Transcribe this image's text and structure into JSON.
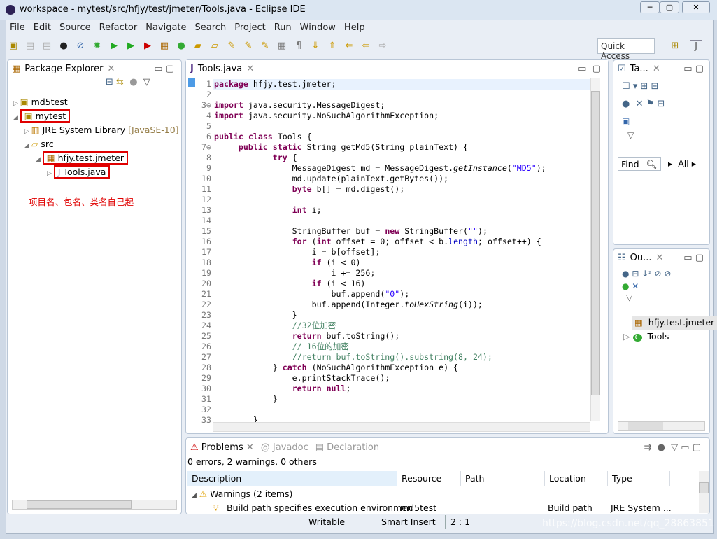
{
  "window": {
    "title": "workspace - mytest/src/hfjy/test/jmeter/Tools.java - Eclipse IDE"
  },
  "menu": [
    "File",
    "Edit",
    "Source",
    "Refactor",
    "Navigate",
    "Search",
    "Project",
    "Run",
    "Window",
    "Help"
  ],
  "toolbar": {
    "quick_access": "Quick Access"
  },
  "package_explorer": {
    "title": "Package Explorer",
    "items": [
      {
        "label": "md5test",
        "depth": 0,
        "icon": "project-icon",
        "arrow": "▷"
      },
      {
        "label": "mytest",
        "depth": 0,
        "icon": "project-icon",
        "arrow": "◢",
        "boxed": true
      },
      {
        "label": "JRE System Library",
        "extra": "[JavaSE-10]",
        "depth": 1,
        "icon": "library-icon",
        "arrow": "▷"
      },
      {
        "label": "src",
        "depth": 1,
        "icon": "folder-icon",
        "arrow": "◢"
      },
      {
        "label": "hfjy.test.jmeter",
        "depth": 2,
        "icon": "package-icon",
        "arrow": "◢",
        "boxed": true
      },
      {
        "label": "Tools.java",
        "depth": 3,
        "icon": "java-file-icon",
        "arrow": "▷",
        "boxed": true
      }
    ],
    "annotation": "项目名、包名、类名自己起",
    "annotation_color": "#e00000"
  },
  "editor": {
    "tab": "Tools.java",
    "lines": [
      [
        [
          "package",
          "k"
        ],
        [
          " hfjy.test.jmeter;"
        ]
      ],
      [],
      [
        [
          "import",
          "k"
        ],
        [
          " java.security.MessageDigest;"
        ]
      ],
      [
        [
          "import",
          "k"
        ],
        [
          " java.security.NoSuchAlgorithmException;"
        ]
      ],
      [],
      [
        [
          "public",
          "k"
        ],
        [
          " "
        ],
        [
          "class",
          "k"
        ],
        [
          " Tools {"
        ]
      ],
      [
        [
          "     "
        ],
        [
          "public",
          "k"
        ],
        [
          " "
        ],
        [
          "static",
          "k"
        ],
        [
          " String getMd5(String plainText) {"
        ]
      ],
      [
        [
          "            "
        ],
        [
          "try",
          "k"
        ],
        [
          " {"
        ]
      ],
      [
        [
          "                MessageDigest md = MessageDigest."
        ],
        [
          "getInstance",
          "i"
        ],
        [
          "("
        ],
        [
          "\"MD5\"",
          "s"
        ],
        [
          ");"
        ]
      ],
      [
        [
          "                md.update(plainText.getBytes());"
        ]
      ],
      [
        [
          "                "
        ],
        [
          "byte",
          "k"
        ],
        [
          " b[] = md.digest();"
        ]
      ],
      [],
      [
        [
          "                "
        ],
        [
          "int",
          "k"
        ],
        [
          " i;"
        ]
      ],
      [],
      [
        [
          "                StringBuffer buf = "
        ],
        [
          "new",
          "k"
        ],
        [
          " StringBuffer("
        ],
        [
          "\"\"",
          "s"
        ],
        [
          ");"
        ]
      ],
      [
        [
          "                "
        ],
        [
          "for",
          "k"
        ],
        [
          " ("
        ],
        [
          "int",
          "k"
        ],
        [
          " offset = 0; offset < b."
        ],
        [
          "length",
          "f"
        ],
        [
          "; offset++) {"
        ]
      ],
      [
        [
          "                    i = b[offset];"
        ]
      ],
      [
        [
          "                    "
        ],
        [
          "if",
          "k"
        ],
        [
          " (i < 0)"
        ]
      ],
      [
        [
          "                        i += 256;"
        ]
      ],
      [
        [
          "                    "
        ],
        [
          "if",
          "k"
        ],
        [
          " (i < 16)"
        ]
      ],
      [
        [
          "                        buf.append("
        ],
        [
          "\"0\"",
          "s"
        ],
        [
          ");"
        ]
      ],
      [
        [
          "                    buf.append(Integer."
        ],
        [
          "toHexString",
          "i"
        ],
        [
          "(i));"
        ]
      ],
      [
        [
          "                }"
        ]
      ],
      [
        [
          "                "
        ],
        [
          "//32位加密",
          "c"
        ]
      ],
      [
        [
          "                "
        ],
        [
          "return",
          "k"
        ],
        [
          " buf.toString();"
        ]
      ],
      [
        [
          "                "
        ],
        [
          "// 16位的加密",
          "c"
        ]
      ],
      [
        [
          "                "
        ],
        [
          "//return buf.toString().substring(8, 24);",
          "c"
        ]
      ],
      [
        [
          "            } "
        ],
        [
          "catch",
          "k"
        ],
        [
          " (NoSuchAlgorithmException e) {"
        ]
      ],
      [
        [
          "                e.printStackTrace();"
        ]
      ],
      [
        [
          "                "
        ],
        [
          "return",
          "k"
        ],
        [
          " "
        ],
        [
          "null",
          "k"
        ],
        [
          ";"
        ]
      ],
      [
        [
          "            }"
        ]
      ],
      [],
      [
        [
          "        }"
        ]
      ]
    ]
  },
  "task_panel": {
    "title": "Ta...",
    "find": "Find",
    "all": "All"
  },
  "outline": {
    "title": "Ou...",
    "items": [
      "hfjy.test.jmeter",
      "Tools"
    ]
  },
  "problems": {
    "tabs": [
      "Problems",
      "Javadoc",
      "Declaration"
    ],
    "summary": "0 errors, 2 warnings, 0 others",
    "columns": [
      "Description",
      "Resource",
      "Path",
      "Location",
      "Type"
    ],
    "group": "Warnings (2 items)",
    "row": [
      "Build path specifies execution environmen",
      "md5test",
      "",
      "Build path",
      "JRE System ..."
    ]
  },
  "statusbar": {
    "writable": "Writable",
    "insert": "Smart Insert",
    "position": "2 : 1",
    "watermark": "https://blog.csdn.net/qq_28863851"
  }
}
